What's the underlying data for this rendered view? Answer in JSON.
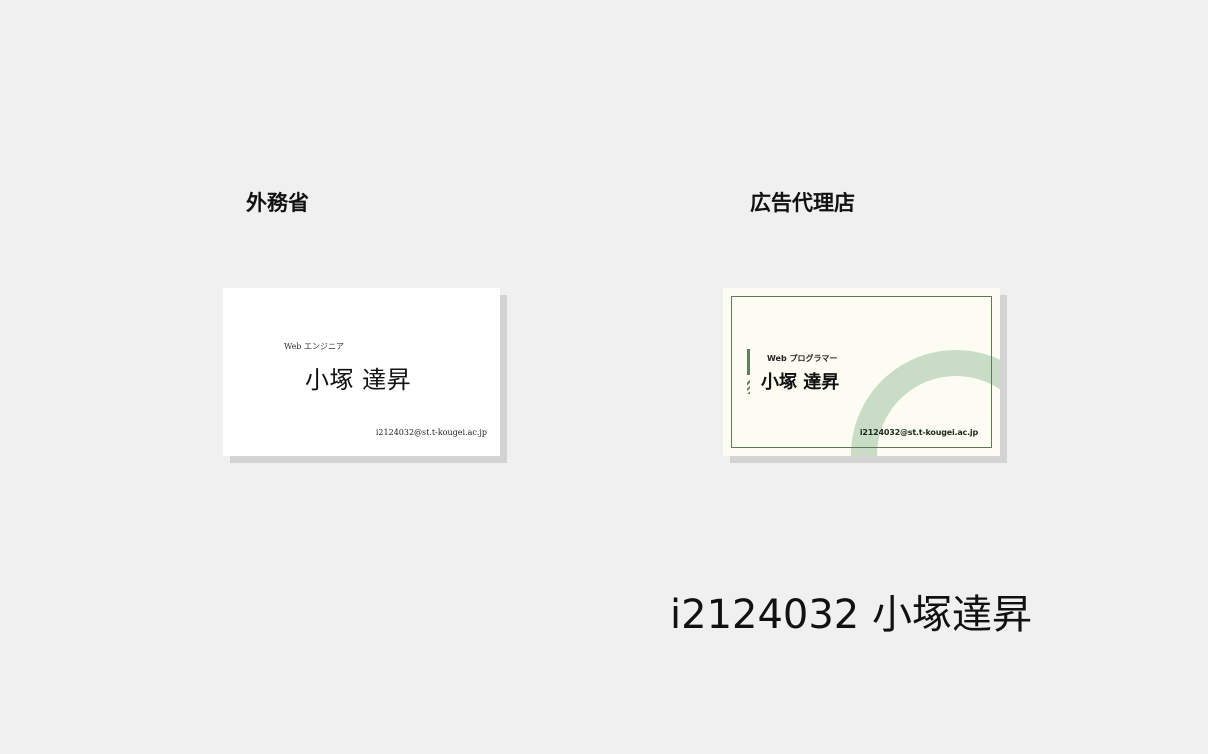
{
  "headings": {
    "left": "外務省",
    "right": "広告代理店"
  },
  "cards": {
    "card1": {
      "role": "Web エンジニア",
      "name": "小塚 達昇",
      "email": "i2124032@st.t-kougei.ac.jp"
    },
    "card2": {
      "role": "Web プログラマー",
      "name": "小塚 達昇",
      "email": "i2124032@st.t-kougei.ac.jp"
    }
  },
  "footer": {
    "student": "i2124032 小塚達昇"
  },
  "colors": {
    "background": "#f0f0f0",
    "card2_background": "#fdfcf2",
    "card2_accent": "#627f5c",
    "card2_arc": "#c9dcc6"
  }
}
